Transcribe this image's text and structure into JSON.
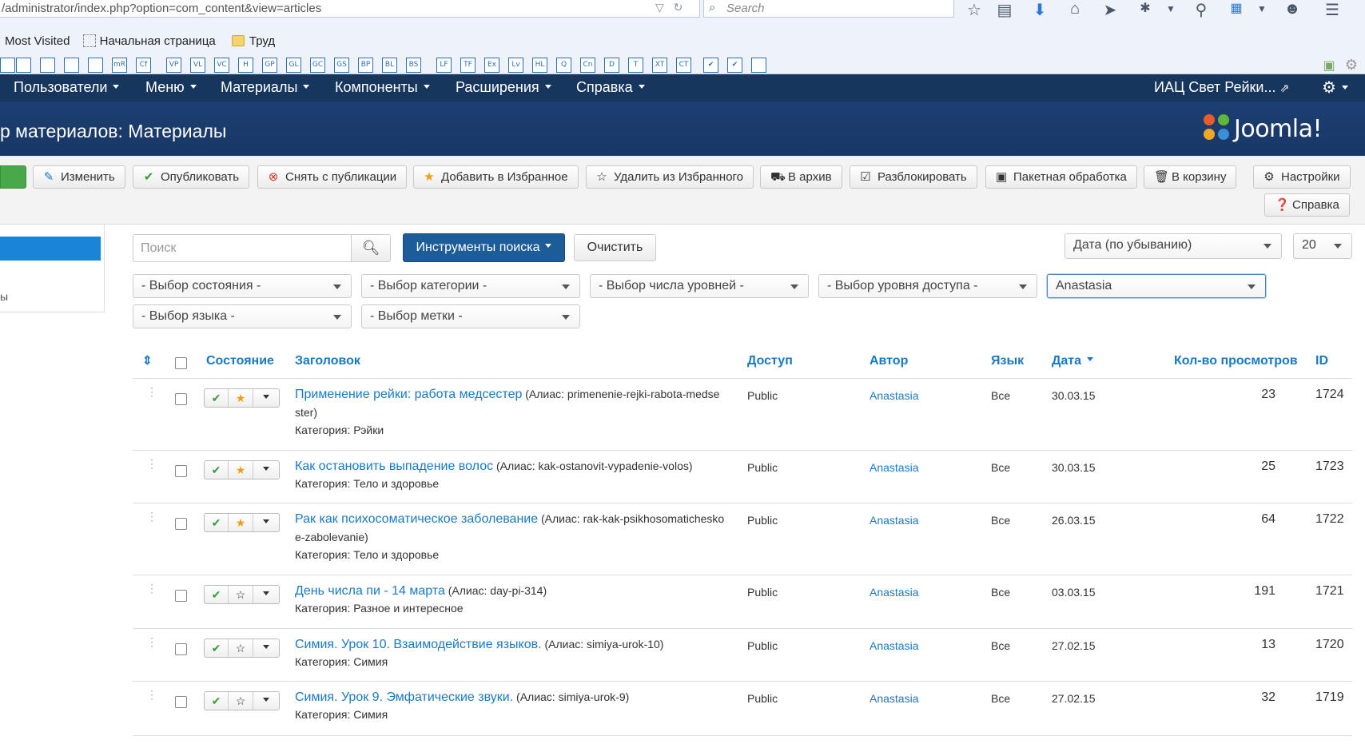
{
  "browser": {
    "url": "/administrator/index.php?option=com_content&view=articles",
    "search_placeholder": "Search",
    "bookmarks": [
      "Most Visited",
      "Начальная страница",
      "Труд"
    ],
    "editor_buttons": [
      "",
      "",
      "",
      "",
      "",
      "mR",
      "Cf",
      "VP",
      "VL",
      "VC",
      "H",
      "GP",
      "GL",
      "GC",
      "GS",
      "BP",
      "BL",
      "BS",
      "LF",
      "TF",
      "Ex",
      "Lv",
      "HL",
      "Q",
      "Cn",
      "D",
      "T",
      "XT",
      "CT",
      "✔",
      "✔",
      ""
    ]
  },
  "admin_nav": {
    "items": [
      "Пользователи",
      "Меню",
      "Материалы",
      "Компоненты",
      "Расширения",
      "Справка"
    ],
    "site_name": "ИАЦ Свет Рейки..."
  },
  "header": {
    "title": "р материалов: Материалы",
    "logo": "Joomla!"
  },
  "toolbar": {
    "edit": "Изменить",
    "publish": "Опубликовать",
    "unpublish": "Снять с публикации",
    "feature": "Добавить в Избранное",
    "unfeature": "Удалить из Избранного",
    "archive": "В архив",
    "checkin": "Разблокировать",
    "batch": "Пакетная обработка",
    "trash": "В корзину",
    "options": "Настройки",
    "help": "Справка"
  },
  "sidebar": {
    "item": "ы"
  },
  "filters": {
    "search_placeholder": "Поиск",
    "search_tools": "Инструменты поиска",
    "clear": "Очистить",
    "ordering": "Дата (по убыванию)",
    "limit": "20",
    "state": "- Выбор состояния -",
    "category": "- Выбор категории -",
    "levels": "- Выбор числа уровней -",
    "access": "- Выбор уровня доступа -",
    "author": "Anastasia",
    "language": "- Выбор языка -",
    "tag": "- Выбор метки -"
  },
  "table": {
    "headers": {
      "status": "Состояние",
      "title": "Заголовок",
      "access": "Доступ",
      "author": "Автор",
      "language": "Язык",
      "date": "Дата",
      "hits": "Кол-во просмотров",
      "id": "ID"
    },
    "rows": [
      {
        "title": "Применение рейки: работа медсестер",
        "alias_line1": "(Алиас: primenenie-rejki-rabota-medse",
        "alias_line2": "ster)",
        "category": "Категория: Рэйки",
        "access": "Public",
        "author": "Anastasia",
        "language": "Все",
        "date": "30.03.15",
        "hits": "23",
        "id": "1724",
        "featured": true
      },
      {
        "title": "Как остановить выпадение волос",
        "alias_line1": "(Алиас: kak-ostanovit-vypadenie-volos)",
        "alias_line2": "",
        "category": "Категория: Тело и здоровье",
        "access": "Public",
        "author": "Anastasia",
        "language": "Все",
        "date": "30.03.15",
        "hits": "25",
        "id": "1723",
        "featured": true
      },
      {
        "title": "Рак как психосоматическое заболевание",
        "alias_line1": "(Алиас: rak-kak-psikhosomaticheskо",
        "alias_line2": "e-zabolevanie)",
        "category": "Категория: Тело и здоровье",
        "access": "Public",
        "author": "Anastasia",
        "language": "Все",
        "date": "26.03.15",
        "hits": "64",
        "id": "1722",
        "featured": true
      },
      {
        "title": "День числа пи - 14 марта",
        "alias_line1": "(Алиас: day-pi-314)",
        "alias_line2": "",
        "category": "Категория: Разное и интересное",
        "access": "Public",
        "author": "Anastasia",
        "language": "Все",
        "date": "03.03.15",
        "hits": "191",
        "id": "1721",
        "featured": false
      },
      {
        "title": "Симия. Урок 10. Взаимодействие языков.",
        "alias_line1": "(Алиас: simiya-urok-10)",
        "alias_line2": "",
        "category": "Категория: Симия",
        "access": "Public",
        "author": "Anastasia",
        "language": "Все",
        "date": "27.02.15",
        "hits": "13",
        "id": "1720",
        "featured": false
      },
      {
        "title": "Симия. Урок 9. Эмфатические звуки.",
        "alias_line1": "(Алиас: simiya-urok-9)",
        "alias_line2": "",
        "category": "Категория: Симия",
        "access": "Public",
        "author": "Anastasia",
        "language": "Все",
        "date": "27.02.15",
        "hits": "32",
        "id": "1719",
        "featured": false
      }
    ]
  },
  "colors": {
    "nav_bg": "#17365d",
    "header_bg": "#1a3867",
    "link": "#1a79c6",
    "primary_btn": "#1c5c98",
    "publish_green": "#3a9a3a",
    "star_orange": "#f39c12"
  }
}
